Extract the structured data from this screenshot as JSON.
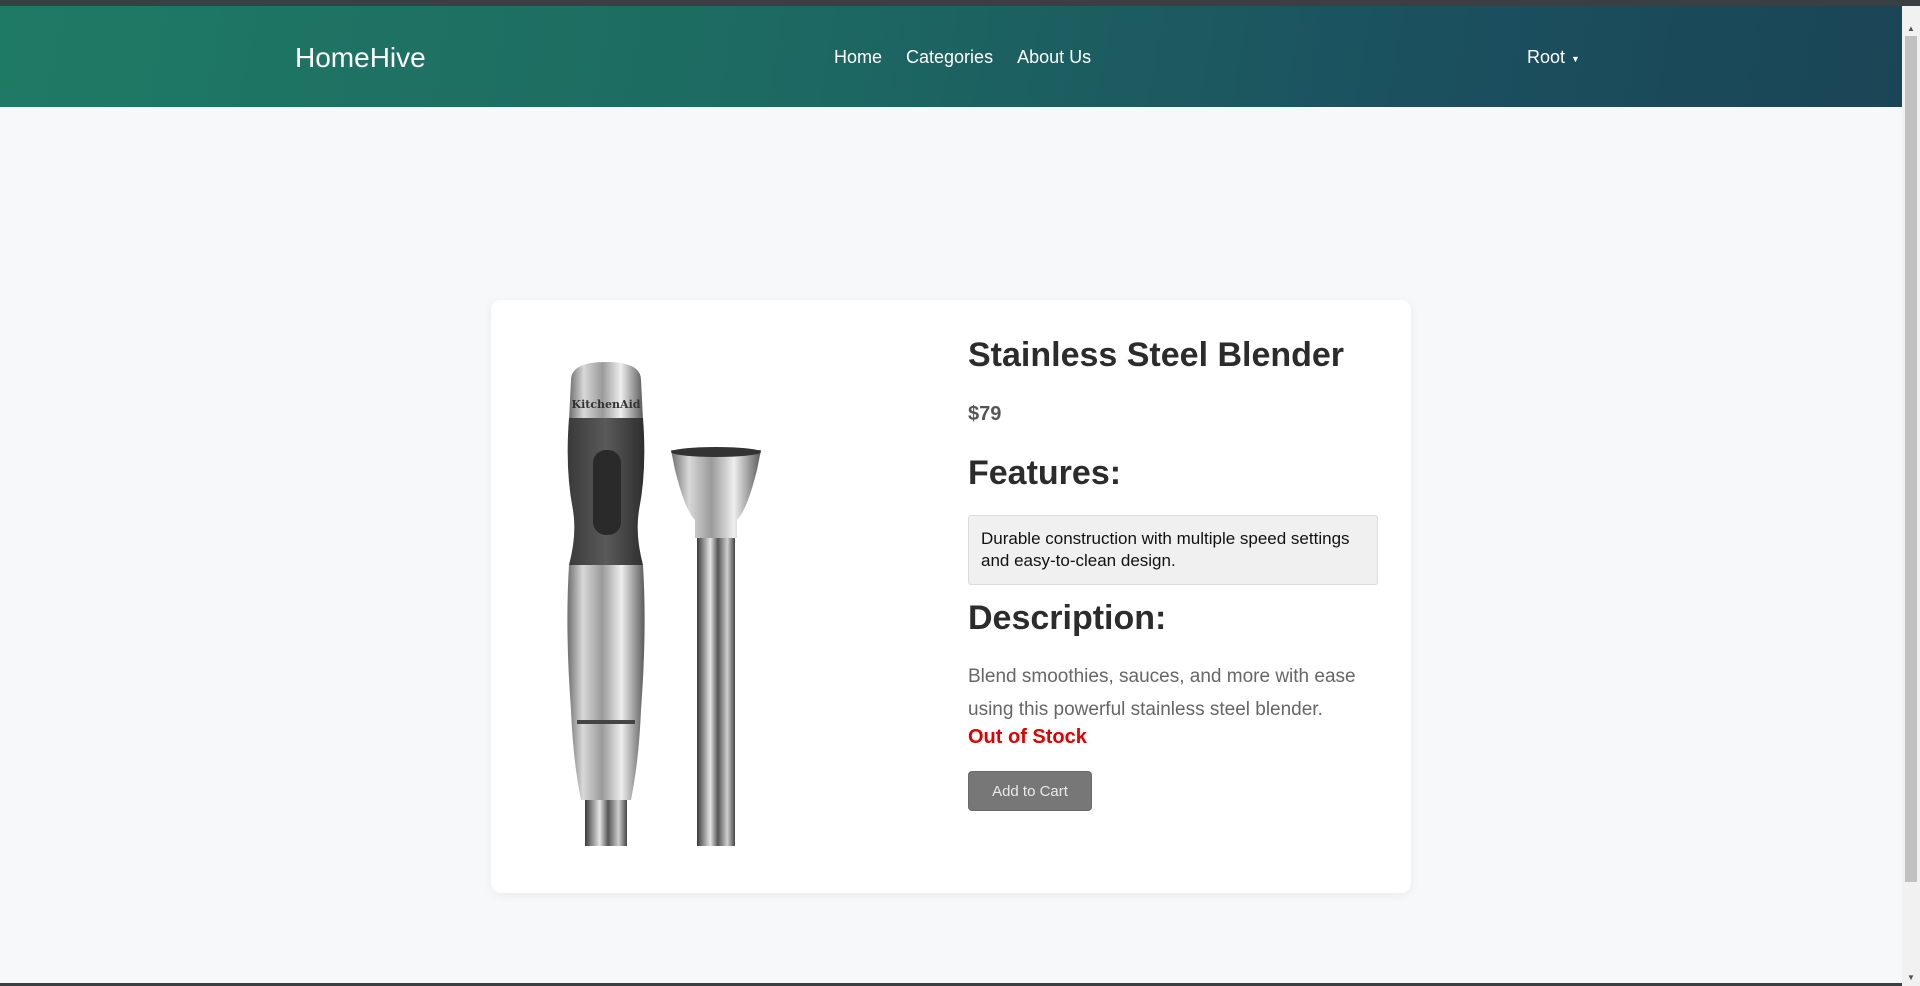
{
  "nav": {
    "brand": "HomeHive",
    "links": [
      "Home",
      "Categories",
      "About Us"
    ],
    "user": "Root"
  },
  "product": {
    "image_alt": "KitchenAid",
    "title": "Stainless Steel Blender",
    "price": "$79",
    "features_heading": "Features:",
    "features_text": "Durable construction with multiple speed settings and easy-to-clean design.",
    "description_heading": "Description:",
    "description_text": "Blend smoothies, sauces, and more with ease using this powerful stainless steel blender.",
    "stock_status": "Out of Stock",
    "add_to_cart_label": "Add to Cart"
  },
  "colors": {
    "nav_gradient_start": "#1f7a64",
    "nav_gradient_end": "#1a4556",
    "out_of_stock": "#e00000",
    "button_disabled": "#777777"
  }
}
